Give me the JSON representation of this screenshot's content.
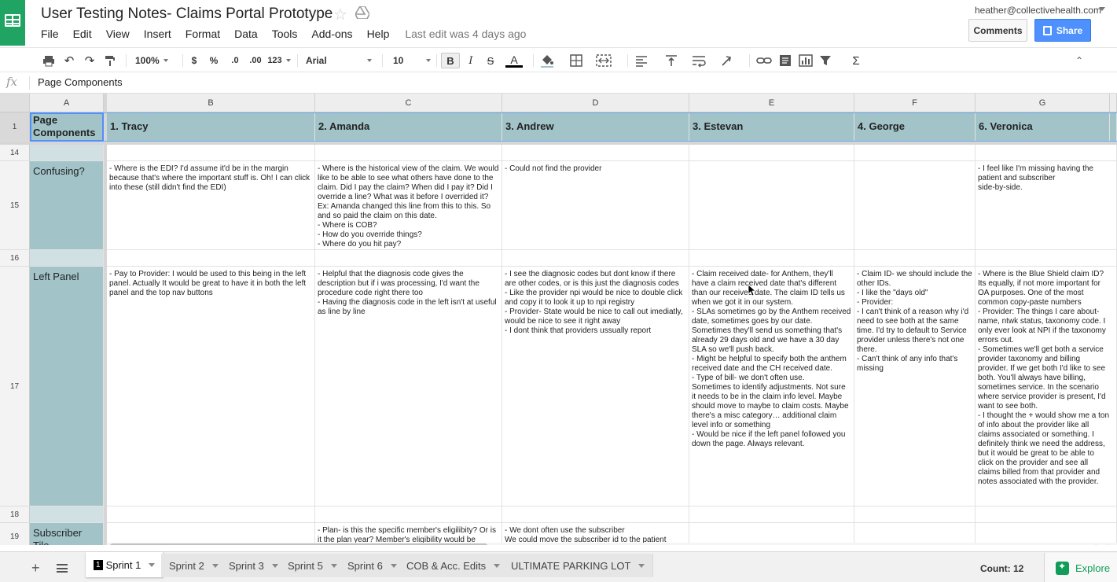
{
  "doc": {
    "title": "User Testing Notes- Claims Portal Prototype",
    "user_email": "heather@collectivehealth.com",
    "comments_label": "Comments",
    "share_label": "Share",
    "last_edit": "Last edit was 4 days ago"
  },
  "menu": [
    "File",
    "Edit",
    "View",
    "Insert",
    "Format",
    "Data",
    "Tools",
    "Add-ons",
    "Help"
  ],
  "toolbar": {
    "zoom": "100%",
    "currency": "$",
    "percent": "%",
    "dec_decrease": ".0",
    "dec_increase": ".00",
    "more_formats": "123",
    "font": "Arial",
    "font_size": "10",
    "bold": "B",
    "italic": "I",
    "strike": "S",
    "text_color": "A",
    "sigma": "Σ"
  },
  "formula_bar": {
    "fx": "fx",
    "value": "Page Components"
  },
  "columns": [
    "A",
    "B",
    "C",
    "D",
    "E",
    "F",
    "G"
  ],
  "rows": [
    {
      "num": "1",
      "type": "header",
      "cells": [
        "Page Components",
        "1. Tracy",
        "2. Amanda",
        "3. Andrew",
        "3. Estevan",
        "4. George",
        "6. Veronica"
      ]
    },
    {
      "num": "14",
      "type": "spacer",
      "cells": [
        "",
        "",
        "",
        "",
        "",
        "",
        ""
      ]
    },
    {
      "num": "15",
      "type": "data",
      "cells": [
        "Confusing?",
        "- Where is the EDI? I'd assume it'd be in the margin because that's where the important stuff is. Oh! I can click into these (still didn't find the EDI)",
        "- Where is the historical view of the claim. We would like to be able to see what others have done to the claim. Did I pay the claim? When did I pay it? Did I override a line? What was it before I overrided it? Ex: Amanda changed this line from this to this. So and so paid the claim on this date.\n- Where is COB?\n- How do you override things?\n- Where do you hit pay?",
        "- Could not find the provider",
        "",
        "",
        "- I feel like I'm missing having the patient and subscriber\nside-by-side."
      ]
    },
    {
      "num": "16",
      "type": "spacer",
      "cells": [
        "",
        "",
        "",
        "",
        "",
        "",
        ""
      ]
    },
    {
      "num": "17",
      "type": "data",
      "cells": [
        "Left Panel",
        "- Pay to Provider: I would be used to this being in the left panel. Actually It would be great to have it in both the left panel and the top nav buttons",
        "- Helpful that the diagnosis code gives the description but if i was processing, I'd want the procedure code right there too\n- Having the diagnosis code in the left isn't at useful as line by line",
        "- I see the diagnosic codes but dont know if there are other codes, or is this just the diagnosis codes\n- Like the provider npi would be nice to double click and copy it to look it up to npi registry\n- Provider- State would be nice to call out imediatly, would be nice to see it right away\n- I dont think that providers ussually report",
        "- Claim received date- for Anthem, they'll have a claim received date that's different than our received date. The claim ID tells us when we got it in our system.\n- SLAs sometimes go by the Anthem received date, sometimes goes by our date. Sometimes they'll send us something that's already 29 days old and we have a 30 day SLA so we'll push back.\n- Might be helpful to specify both the anthem received date and the CH received date.\n- Type of bill- we don't often use.\nSometimes to identify adjustments. Not sure it needs to be in the claim info level. Maybe should move to maybe to claim costs. Maybe there's a misc category… additional claim level info or something\n- Would be nice if the left panel followed you down the page. Always relevant.",
        "- Claim ID- we should include the other IDs.\n- I like the \"days old\"\n- Provider:\n- I can't think of a reason why i'd need to see both at the same time. I'd try to default to Service provider unless there's not one there.\n- Can't think of any info that's missing",
        "- Where is the Blue Shield claim ID? Its equally, if not more important for OA purposes. One of the most common copy-paste numbers\n- Provider: The things I care about- name, ntwk status, taxonomy code. I only ever look at NPI if the taxonomy errors out.\n- Sometimes we'll get both a service provider taxonomy and billing provider. If we get both I'd like to see both. You'll always have billing, sometimes service. In the scenario where service provider is present, I'd want to see both.\n- I thought the + would show me a ton of info about the provider like all claims associated or something. I definitely think we need the address, but it would be great to be able to click on the provider and see all claims billed from that provider and notes associated with the provider."
      ]
    },
    {
      "num": "18",
      "type": "spacer",
      "cells": [
        "",
        "",
        "",
        "",
        "",
        "",
        ""
      ]
    },
    {
      "num": "19",
      "type": "data",
      "cells": [
        "Subscriber Tile",
        "",
        "- Plan- is this the specific member's eligilibity? Or is it the plan year? Member's eligibility would be",
        "- We dont often use the subscriber\nWe could move the subscriber id to the patient",
        "",
        "",
        ""
      ]
    }
  ],
  "sheets": [
    "Sprint 1",
    "Sprint 2",
    "Sprint 3",
    "Sprint 5",
    "Sprint 6",
    "COB & Acc. Edits",
    "ULTIMATE PARKING LOT"
  ],
  "active_sheet_badge": "1",
  "status": {
    "count": "Count: 12",
    "explore_label": "Explore"
  },
  "colors": {
    "header_fill": "#a2c4c9",
    "spacer_fill": "#d0e0e3",
    "share_blue": "#4d90fe",
    "sheets_green": "#1fa463"
  }
}
